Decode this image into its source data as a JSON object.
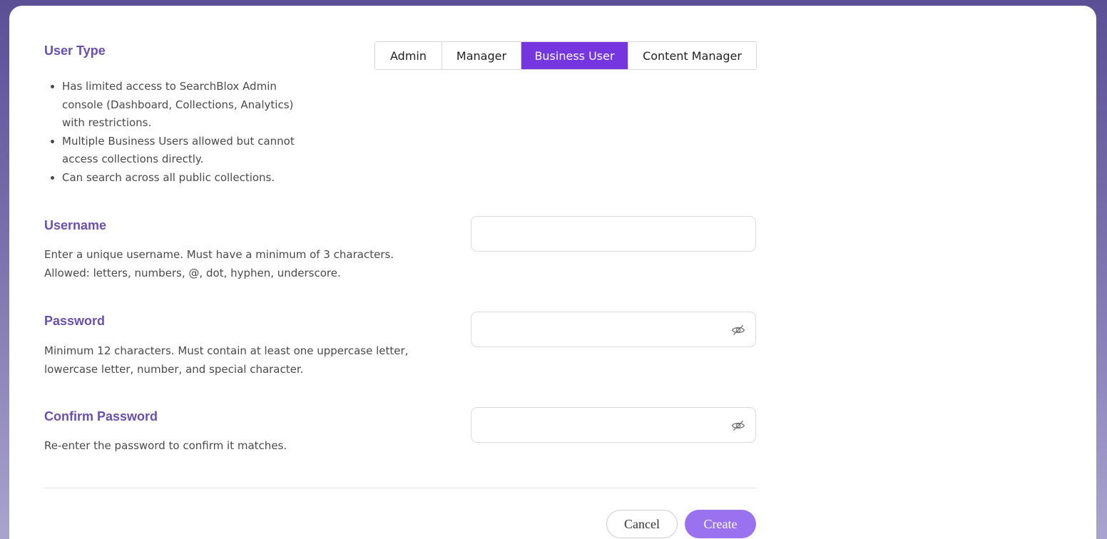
{
  "user_type": {
    "label": "User Type",
    "tabs": [
      "Admin",
      "Manager",
      "Business User",
      "Content Manager"
    ],
    "selected": "Business User",
    "bullets": [
      "Has limited access to SearchBlox Admin console (Dashboard, Collections, Analytics) with restrictions.",
      "Multiple Business Users allowed but cannot access collections directly.",
      "Can search across all public collections."
    ]
  },
  "username": {
    "label": "Username",
    "desc_line1": "Enter a unique username. Must have a minimum of 3 characters.",
    "desc_line2": "Allowed: letters, numbers, @, dot, hyphen, underscore.",
    "value": ""
  },
  "password": {
    "label": "Password",
    "desc_line1": "Minimum 12 characters. Must contain at least one uppercase letter,",
    "desc_line2": "lowercase letter, number, and special character.",
    "value": "",
    "icon": "eye-off-icon"
  },
  "confirm_password": {
    "label": "Confirm Password",
    "desc": "Re-enter the password to confirm it matches.",
    "value": "",
    "icon": "eye-off-icon"
  },
  "actions": {
    "cancel_label": "Cancel",
    "create_label": "Create"
  },
  "colors": {
    "accent": "#7536e0",
    "label": "#6b4fb0",
    "create_button": "#9a72f0"
  }
}
